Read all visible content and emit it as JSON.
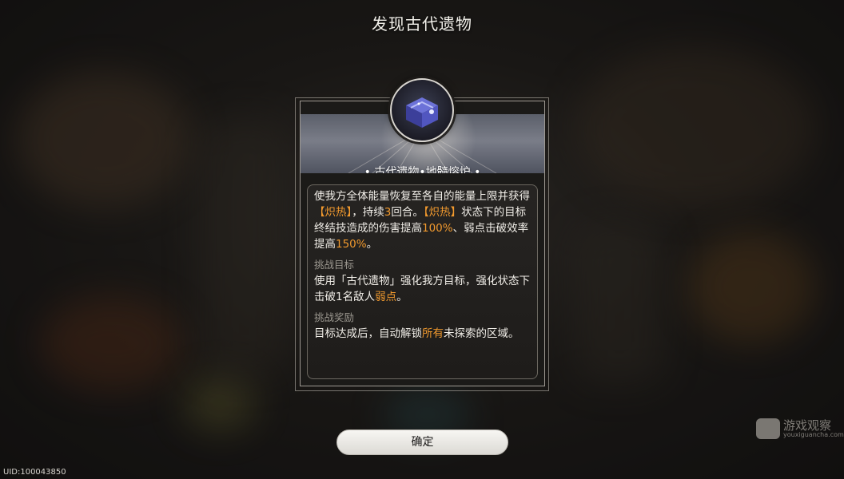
{
  "header": {
    "title": "发现古代遗物"
  },
  "relic": {
    "name": "• 古代遗物•地髓熔炉 •",
    "effect": {
      "t1": "使我方全体能量恢复至各自的能量上限并获得",
      "h1": "【炽热】",
      "t2": "，持续",
      "h2": "3",
      "t3": "回合。",
      "h3": "【炽热】",
      "t4": "状态下的目标终结技造成的伤害提高",
      "h4": "100%",
      "t5": "、弱点击破效率提高",
      "h5": "150%",
      "t6": "。"
    },
    "challenge": {
      "label": "挑战目标",
      "t1": "使用「古代遗物」强化我方目标，强化状态下击破1名敌人",
      "h1": "弱点",
      "t2": "。"
    },
    "reward": {
      "label": "挑战奖励",
      "t1": "目标达成后，自动解锁",
      "h1": "所有",
      "t2": "未探索的区域。"
    }
  },
  "buttons": {
    "confirm": "确定"
  },
  "footer": {
    "uid": "UID:100043850"
  },
  "watermark": {
    "main": "游戏观察",
    "sub": "youxiguancha.com"
  },
  "colors": {
    "highlight": "#f29a2e",
    "text": "#f1eee8",
    "label": "#9c9890"
  }
}
